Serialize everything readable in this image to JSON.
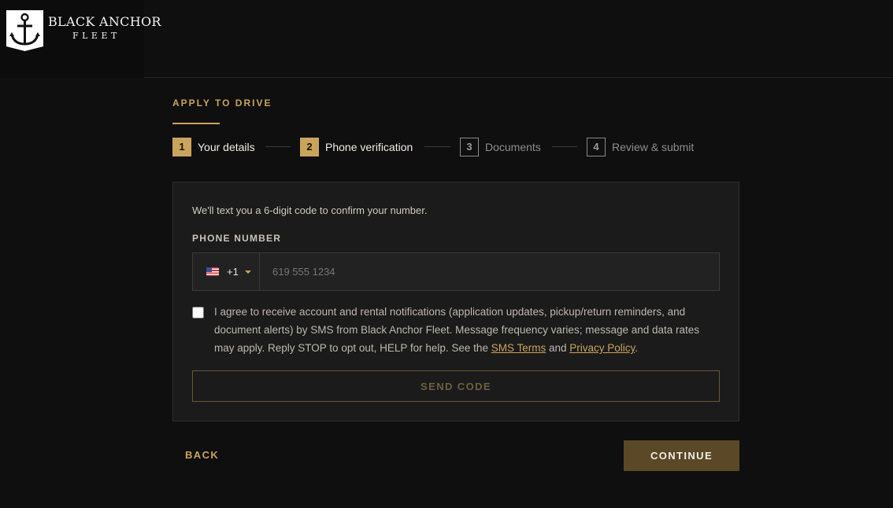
{
  "brand": {
    "name": "BLACK ANCHOR",
    "subname": "FLEET",
    "logo_icon": "anchor-icon"
  },
  "page": {
    "eyebrow": "APPLY TO DRIVE"
  },
  "steps": [
    {
      "num": "1",
      "label": "Your details",
      "state": "done"
    },
    {
      "num": "2",
      "label": "Phone verification",
      "state": "active"
    },
    {
      "num": "3",
      "label": "Documents",
      "state": "todo"
    },
    {
      "num": "4",
      "label": "Review & submit",
      "state": "todo"
    }
  ],
  "form": {
    "intro": "We'll text you a 6-digit code to confirm your number.",
    "phone_label": "PHONE NUMBER",
    "country_flag": "us-flag-icon",
    "dial_code": "+1",
    "phone_placeholder": "619 555 1234",
    "phone_value": "",
    "consent_checked": false,
    "consent_text": "I agree to receive account and rental notifications (application updates, pickup/return reminders, and document alerts) by SMS from Black Anchor Fleet. Message frequency varies; message and data rates may apply. Reply STOP to opt out, HELP for help. See the ",
    "sms_terms_link": "SMS Terms",
    "and_text": " and ",
    "privacy_link": "Privacy Policy",
    "period": ".",
    "send_code_label": "SEND CODE"
  },
  "nav": {
    "back_label": "BACK",
    "continue_label": "CONTINUE"
  },
  "colors": {
    "accent": "#c9a45c",
    "background": "#0f0f0f",
    "card": "#1b1b1b",
    "continue_bg": "#5a4826"
  }
}
